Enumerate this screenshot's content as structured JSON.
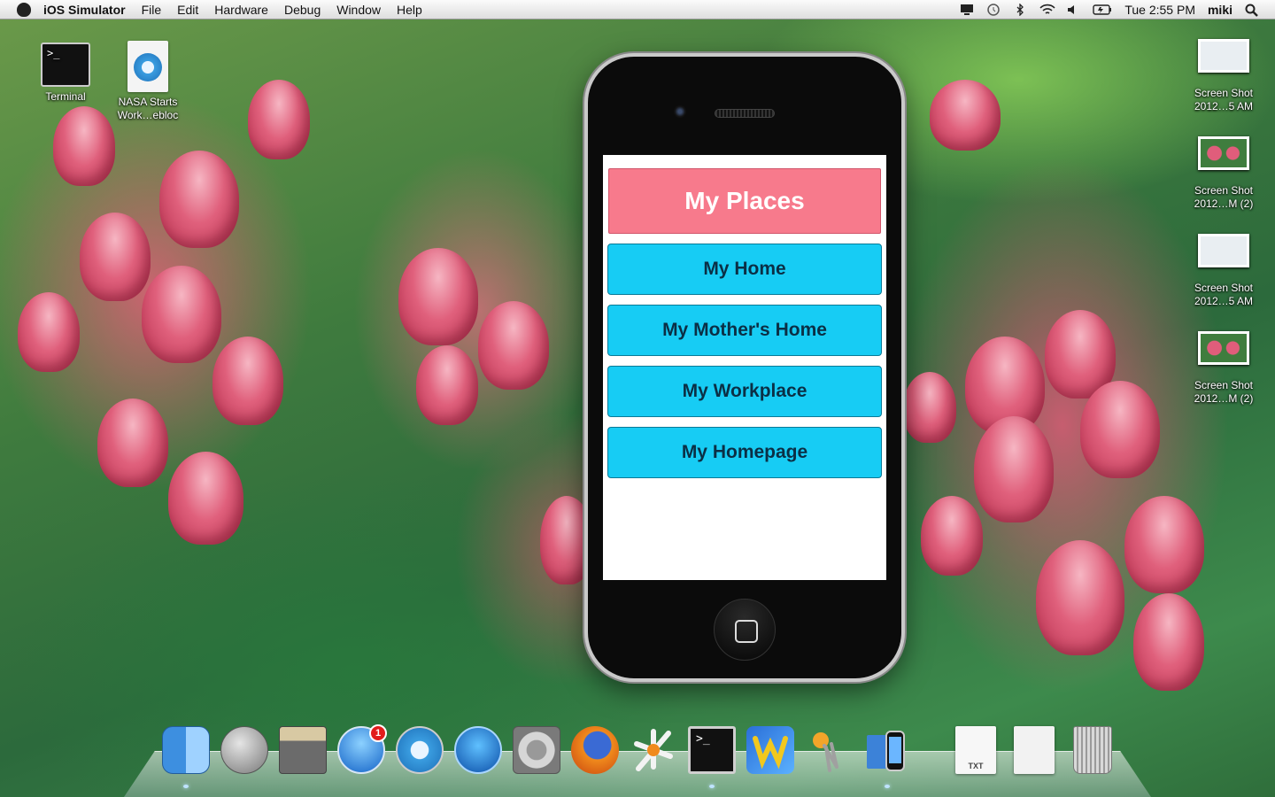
{
  "menubar": {
    "app": "iOS Simulator",
    "menus": [
      "File",
      "Edit",
      "Hardware",
      "Debug",
      "Window",
      "Help"
    ],
    "clock": "Tue 2:55 PM",
    "user": "miki"
  },
  "desktop": {
    "left_icons": [
      {
        "label": "Terminal"
      },
      {
        "label": "NASA Starts Work…ebloc"
      }
    ],
    "right_icons": [
      {
        "label": "Screen Shot 2012…5 AM"
      },
      {
        "label": "Screen Shot 2012…M (2)"
      },
      {
        "label": "Screen Shot 2012…5 AM"
      },
      {
        "label": "Screen Shot 2012…M (2)"
      }
    ]
  },
  "app": {
    "title": "My Places",
    "buttons": [
      "My Home",
      "My Mother's Home",
      "My Workplace",
      "My Homepage"
    ],
    "colors": {
      "title_bg": "#f77a8c",
      "button_bg": "#17ccf4"
    }
  },
  "dock": {
    "items": [
      {
        "name": "Finder",
        "icon": "finder-icon"
      },
      {
        "name": "Launchpad",
        "icon": "launchpad-icon"
      },
      {
        "name": "Photo Browser",
        "icon": "photo-browser-icon"
      },
      {
        "name": "App Store",
        "icon": "app-store-icon",
        "badge": "1"
      },
      {
        "name": "Safari",
        "icon": "safari-icon"
      },
      {
        "name": "iTunes",
        "icon": "itunes-icon"
      },
      {
        "name": "System Preferences",
        "icon": "system-preferences-icon"
      },
      {
        "name": "Firefox",
        "icon": "firefox-icon"
      },
      {
        "name": "Instruments",
        "icon": "instruments-icon"
      },
      {
        "name": "Terminal",
        "icon": "terminal-icon"
      },
      {
        "name": "Web Editor",
        "icon": "web-editor-icon"
      },
      {
        "name": "Keychain Access",
        "icon": "keychain-icon"
      },
      {
        "name": "iOS Simulator",
        "icon": "ios-simulator-icon"
      },
      {
        "name": "Documents",
        "icon": "txt-document-icon",
        "label": "TXT"
      },
      {
        "name": "Downloads",
        "icon": "downloads-stack-icon"
      },
      {
        "name": "Trash",
        "icon": "trash-icon"
      }
    ]
  }
}
